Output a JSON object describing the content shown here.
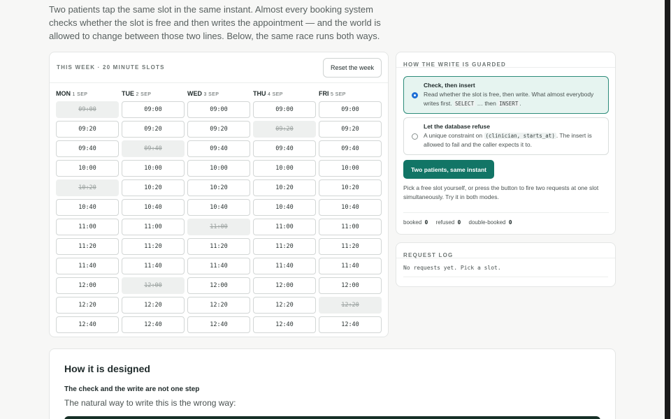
{
  "intro": "Two patients tap the same slot in the same instant. Almost every booking system checks whether the slot is free and then writes the appointment — and the world is allowed to change between those two lines. Below, the same race runs both ways.",
  "week": {
    "title": "THIS WEEK · 20 MINUTE SLOTS",
    "reset_label": "Reset the week",
    "days": [
      {
        "name": "MON",
        "date": "1 SEP",
        "slots": [
          {
            "time": "09:00",
            "taken": true
          },
          {
            "time": "09:20",
            "taken": false
          },
          {
            "time": "09:40",
            "taken": false
          },
          {
            "time": "10:00",
            "taken": false
          },
          {
            "time": "10:20",
            "taken": true
          },
          {
            "time": "10:40",
            "taken": false
          },
          {
            "time": "11:00",
            "taken": false
          },
          {
            "time": "11:20",
            "taken": false
          },
          {
            "time": "11:40",
            "taken": false
          },
          {
            "time": "12:00",
            "taken": false
          },
          {
            "time": "12:20",
            "taken": false
          },
          {
            "time": "12:40",
            "taken": false
          }
        ]
      },
      {
        "name": "TUE",
        "date": "2 SEP",
        "slots": [
          {
            "time": "09:00",
            "taken": false
          },
          {
            "time": "09:20",
            "taken": false
          },
          {
            "time": "09:40",
            "taken": true
          },
          {
            "time": "10:00",
            "taken": false
          },
          {
            "time": "10:20",
            "taken": false
          },
          {
            "time": "10:40",
            "taken": false
          },
          {
            "time": "11:00",
            "taken": false
          },
          {
            "time": "11:20",
            "taken": false
          },
          {
            "time": "11:40",
            "taken": false
          },
          {
            "time": "12:00",
            "taken": true
          },
          {
            "time": "12:20",
            "taken": false
          },
          {
            "time": "12:40",
            "taken": false
          }
        ]
      },
      {
        "name": "WED",
        "date": "3 SEP",
        "slots": [
          {
            "time": "09:00",
            "taken": false
          },
          {
            "time": "09:20",
            "taken": false
          },
          {
            "time": "09:40",
            "taken": false
          },
          {
            "time": "10:00",
            "taken": false
          },
          {
            "time": "10:20",
            "taken": false
          },
          {
            "time": "10:40",
            "taken": false
          },
          {
            "time": "11:00",
            "taken": true
          },
          {
            "time": "11:20",
            "taken": false
          },
          {
            "time": "11:40",
            "taken": false
          },
          {
            "time": "12:00",
            "taken": false
          },
          {
            "time": "12:20",
            "taken": false
          },
          {
            "time": "12:40",
            "taken": false
          }
        ]
      },
      {
        "name": "THU",
        "date": "4 SEP",
        "slots": [
          {
            "time": "09:00",
            "taken": false
          },
          {
            "time": "09:20",
            "taken": true
          },
          {
            "time": "09:40",
            "taken": false
          },
          {
            "time": "10:00",
            "taken": false
          },
          {
            "time": "10:20",
            "taken": false
          },
          {
            "time": "10:40",
            "taken": false
          },
          {
            "time": "11:00",
            "taken": false
          },
          {
            "time": "11:20",
            "taken": false
          },
          {
            "time": "11:40",
            "taken": false
          },
          {
            "time": "12:00",
            "taken": false
          },
          {
            "time": "12:20",
            "taken": false
          },
          {
            "time": "12:40",
            "taken": false
          }
        ]
      },
      {
        "name": "FRI",
        "date": "5 SEP",
        "slots": [
          {
            "time": "09:00",
            "taken": false
          },
          {
            "time": "09:20",
            "taken": false
          },
          {
            "time": "09:40",
            "taken": false
          },
          {
            "time": "10:00",
            "taken": false
          },
          {
            "time": "10:20",
            "taken": false
          },
          {
            "time": "10:40",
            "taken": false
          },
          {
            "time": "11:00",
            "taken": false
          },
          {
            "time": "11:20",
            "taken": false
          },
          {
            "time": "11:40",
            "taken": false
          },
          {
            "time": "12:00",
            "taken": false
          },
          {
            "time": "12:20",
            "taken": true
          },
          {
            "time": "12:40",
            "taken": false
          }
        ]
      }
    ]
  },
  "guard": {
    "title": "HOW THE WRITE IS GUARDED",
    "option1": {
      "title": "Check, then insert",
      "desc_a": "Read whether the slot is free, then write. What almost everybody writes first.",
      "code_a": "SELECT",
      "desc_b": "… then",
      "code_b": "INSERT",
      "desc_c": "."
    },
    "option2": {
      "title": "Let the database refuse",
      "desc_a": "A unique constraint on",
      "code_a": "(clinician, starts_at)",
      "desc_b": ". The insert is allowed to fail and the caller expects it to."
    },
    "race_label": "Two patients, same instant",
    "hint": "Pick a free slot yourself, or press the button to fire two requests at one slot simultaneously. Try it in both modes.",
    "counters": {
      "booked_label": "booked",
      "booked": "0",
      "refused_label": "refused",
      "refused": "0",
      "double_label": "double-booked",
      "double": "0"
    }
  },
  "log": {
    "title": "REQUEST LOG",
    "empty": "No requests yet. Pick a slot."
  },
  "design": {
    "title": "How it is designed",
    "subtitle": "The check and the write are not one step",
    "text": "The natural way to write this is the wrong way:"
  }
}
